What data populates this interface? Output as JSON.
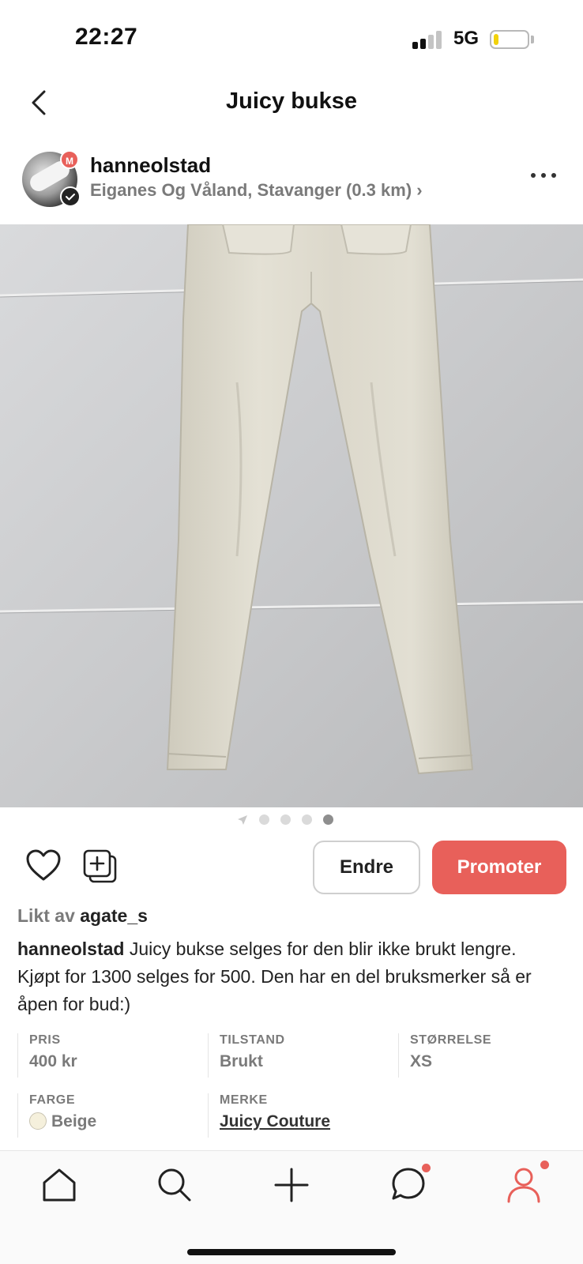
{
  "status_bar": {
    "time": "22:27",
    "network": "5G",
    "battery_level": 0.15,
    "battery_color": "#f2d20b"
  },
  "header": {
    "title": "Juicy bukse",
    "back_icon": "chevron-left-icon"
  },
  "seller": {
    "username": "hanneolstad",
    "location": "Eiganes Og Våland, Stavanger (0.3 km) ›",
    "badge_letter": "M",
    "more_icon": "ellipsis-icon"
  },
  "photo": {
    "page_count": 4,
    "active_page": 4
  },
  "actions": {
    "like_icon": "heart-icon",
    "save_icon": "add-to-collection-icon",
    "edit_label": "Endre",
    "promote_label": "Promoter"
  },
  "likes": {
    "prefix": "Likt av ",
    "user": "agate_s"
  },
  "description": {
    "user": "hanneolstad",
    "text": " Juicy bukse selges for den blir ikke brukt lengre. Kjøpt for 1300 selges for 500. Den har en del bruksmerker så er åpen for bud:)"
  },
  "details": {
    "price_label": "PRIS",
    "price_value": "400 kr",
    "condition_label": "TILSTAND",
    "condition_value": "Brukt",
    "size_label": "STØRRELSE",
    "size_value": "XS",
    "color_label": "FARGE",
    "color_value": "Beige",
    "color_swatch": "#f5f0dc",
    "brand_label": "MERKE",
    "brand_value": "Juicy Couture"
  },
  "tab_bar": {
    "items": [
      "home-icon",
      "search-icon",
      "plus-icon",
      "chat-icon",
      "profile-icon"
    ],
    "accent": "#e8605a"
  }
}
